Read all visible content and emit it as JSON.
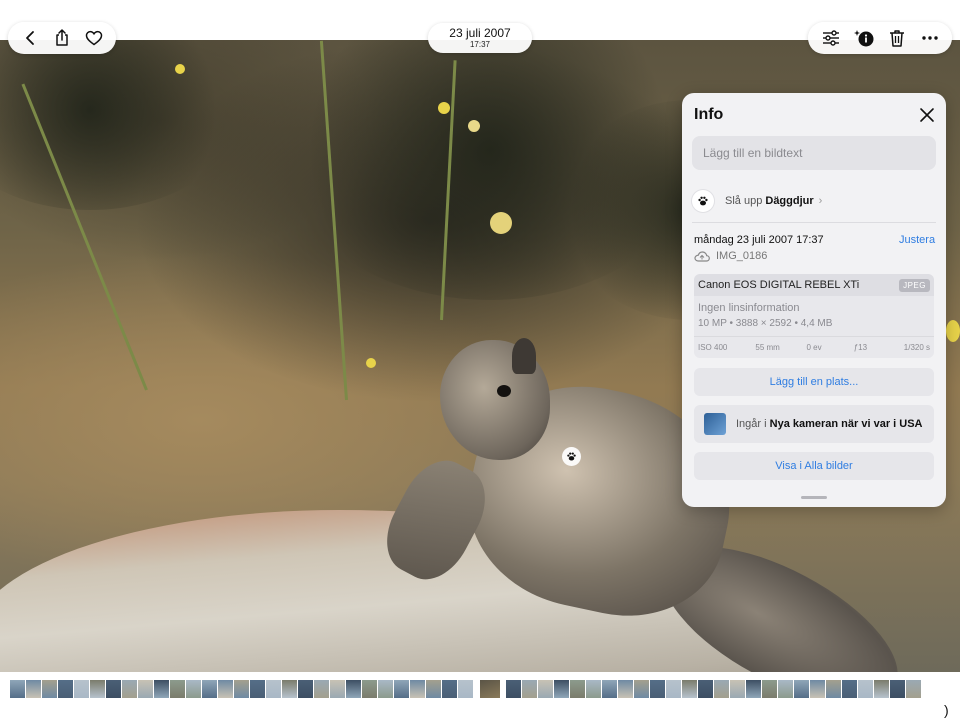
{
  "header": {
    "date": "23 juli 2007",
    "time": "17:37"
  },
  "icons": {
    "back": "chevron-left-icon",
    "share": "share-icon",
    "favorite": "heart-icon",
    "adjust": "sliders-icon",
    "info": "info-sparkle-icon",
    "delete": "trash-icon",
    "more": "ellipsis-icon",
    "lookup": "paw-icon",
    "cloud": "cloud-icon",
    "close": "close-icon"
  },
  "info_panel": {
    "title": "Info",
    "caption_placeholder": "Lägg till en bildtext",
    "lookup_prefix": "Slå upp",
    "lookup_subject": "Däggdjur",
    "capture_date": "måndag 23 juli 2007 17:37",
    "adjust_label": "Justera",
    "file_name": "IMG_0186",
    "camera": {
      "model": "Canon EOS DIGITAL REBEL XTi",
      "format": "JPEG",
      "lens": "Ingen linsinformation",
      "specs": "10 MP • 3888 × 2592 • 4,4 MB",
      "exif": [
        "ISO 400",
        "55 mm",
        "0 ev",
        "ƒ13",
        "1/320 s"
      ]
    },
    "add_place_label": "Lägg till en plats...",
    "album_prefix": "Ingår i",
    "album_name": "Nya kameran när vi var i USA",
    "show_all_label": "Visa i Alla bilder"
  },
  "thumbnail_count": 56,
  "current_thumbnail_index": 29
}
